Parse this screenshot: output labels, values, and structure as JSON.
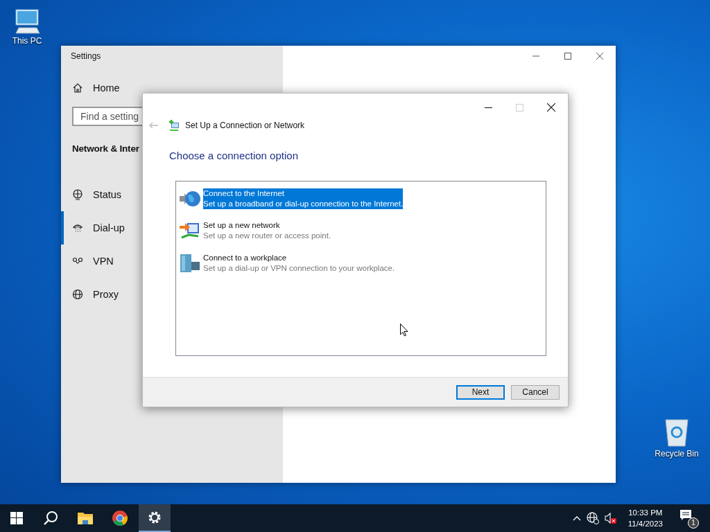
{
  "desktop_icons": [
    {
      "label": "This PC"
    },
    {
      "label": "Recycle Bin"
    }
  ],
  "settings_window": {
    "title": "Settings",
    "home": "Home",
    "search": {
      "placeholder": "Find a setting"
    },
    "section": "Network & Inter",
    "nav_items": [
      {
        "label": "Status",
        "selected": false
      },
      {
        "label": "Dial-up",
        "selected": true
      },
      {
        "label": "VPN",
        "selected": false
      },
      {
        "label": "Proxy",
        "selected": false
      }
    ]
  },
  "dialog": {
    "title": "Set Up a Connection or Network",
    "heading": "Choose a connection option",
    "options": [
      {
        "title": "Connect to the Internet",
        "description": "Set up a broadband or dial-up connection to the Internet.",
        "selected": true
      },
      {
        "title": "Set up a new network",
        "description": "Set up a new router or access point.",
        "selected": false
      },
      {
        "title": "Connect to a workplace",
        "description": "Set up a dial-up or VPN connection to your workplace.",
        "selected": false
      }
    ],
    "buttons": [
      {
        "label": "Next",
        "default": true
      },
      {
        "label": "Cancel",
        "default": false
      }
    ]
  },
  "taskbar": {
    "apps": [
      {
        "active": false
      },
      {
        "active": false
      },
      {
        "active": false
      },
      {
        "active": true
      }
    ],
    "time": "10:33 PM",
    "date": "11/4/2023",
    "notification_count": "1"
  }
}
